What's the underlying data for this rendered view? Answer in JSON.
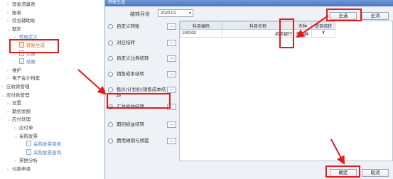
{
  "tree": {
    "items": [
      {
        "text": "现金流量表",
        "indent": 1,
        "expandable": true,
        "sub": false
      },
      {
        "text": "账表",
        "indent": 1,
        "expandable": true,
        "sub": false
      },
      {
        "text": "综合辅助账",
        "indent": 1,
        "expandable": true,
        "sub": false
      },
      {
        "text": "期末",
        "indent": 1,
        "expandable": true,
        "sub": false,
        "open": true
      },
      {
        "text": "转账定义",
        "indent": 2,
        "expandable": true,
        "sub": true
      },
      {
        "text": "转账生成",
        "indent": 2,
        "expandable": false,
        "sub": true,
        "selected": true
      },
      {
        "text": "对账",
        "indent": 2,
        "expandable": false,
        "sub": true
      },
      {
        "text": "结账",
        "indent": 2,
        "expandable": false,
        "sub": true
      },
      {
        "text": "维护",
        "indent": 1,
        "expandable": true,
        "sub": false
      },
      {
        "text": "电子会计档案",
        "indent": 1,
        "expandable": true,
        "sub": false
      },
      {
        "text": "应收款管理",
        "indent": 0,
        "expandable": true,
        "sub": false
      },
      {
        "text": "应付款管理",
        "indent": 0,
        "expandable": true,
        "sub": false,
        "open": true
      },
      {
        "text": "设置",
        "indent": 1,
        "expandable": true,
        "sub": false
      },
      {
        "text": "期初余额",
        "indent": 1,
        "expandable": true,
        "sub": false
      },
      {
        "text": "应付处理",
        "indent": 1,
        "expandable": true,
        "sub": false,
        "open": true
      },
      {
        "text": "应付单",
        "indent": 2,
        "expandable": true,
        "sub": false
      },
      {
        "text": "采购发票",
        "indent": 2,
        "expandable": true,
        "sub": false,
        "open": true
      },
      {
        "text": "采购发票审核",
        "indent": 3,
        "expandable": false,
        "sub": true
      },
      {
        "text": "采购发票查询",
        "indent": 3,
        "expandable": false,
        "sub": true
      },
      {
        "text": "票据分析",
        "indent": 2,
        "expandable": true,
        "sub": false
      },
      {
        "text": "付款申请",
        "indent": 1,
        "expandable": true,
        "sub": false
      }
    ]
  },
  "dialog": {
    "title": "转账生成",
    "period_label": "结转月份",
    "period_value": "2020.01",
    "options": [
      {
        "label": "自定义转账",
        "selected": false,
        "btn": "..."
      },
      {
        "label": "对应结转",
        "selected": false,
        "btn": "..."
      },
      {
        "label": "自定义比例结转",
        "selected": false,
        "btn": "..."
      },
      {
        "label": "销售成本结转",
        "selected": false,
        "btn": "..."
      },
      {
        "label": "售价(计划价)销售成本结转",
        "selected": false,
        "btn": "..."
      },
      {
        "label": "汇兑损益结转",
        "selected": true,
        "btn": "..."
      },
      {
        "label": "期间损益结转",
        "selected": false,
        "btn": "..."
      },
      {
        "label": "费用摊销与预提",
        "selected": false,
        "btn": "..."
      }
    ],
    "grid": {
      "columns": [
        "科目编码",
        "科目名称",
        "币种",
        "是否结转"
      ],
      "rows": [
        {
          "code": "100202",
          "name": "招商银行",
          "currency": "多币种",
          "flag": "Y"
        }
      ]
    },
    "select_all": "全选",
    "clear_all": "全消",
    "ok": "确定",
    "cancel": "取消"
  },
  "colors": {
    "annotation": "#e31b1b",
    "titlebar": "#4d78bf"
  }
}
